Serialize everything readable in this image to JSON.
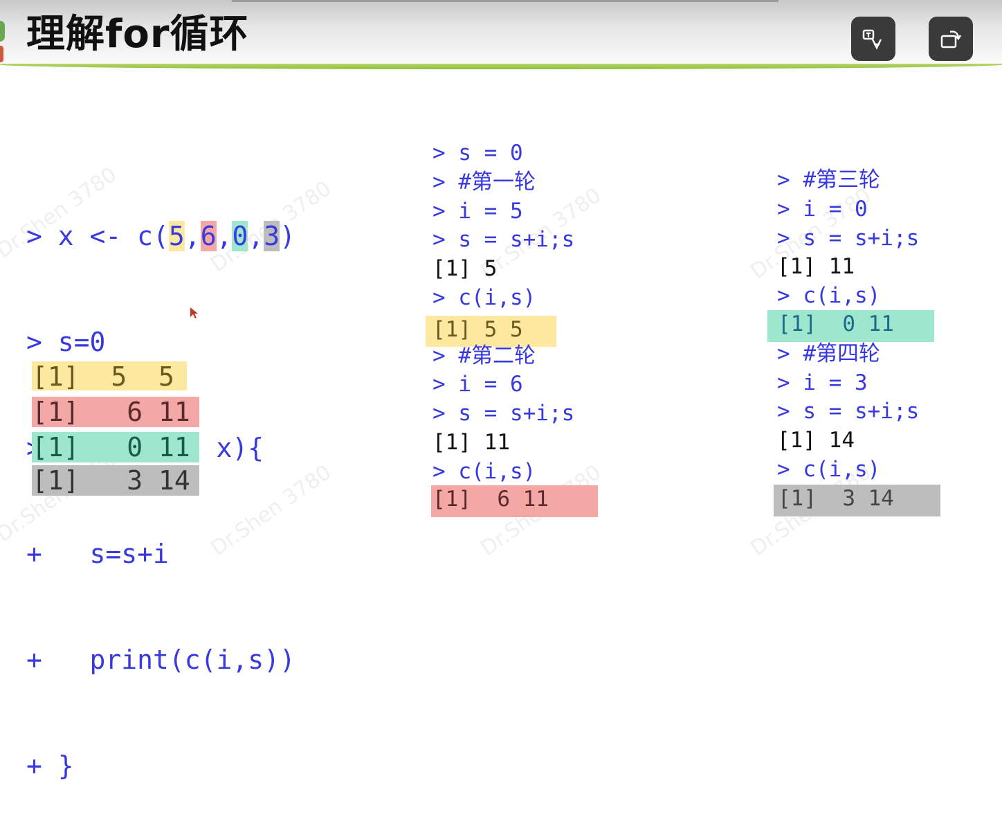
{
  "header": {
    "title": "理解for循环",
    "buttons": [
      {
        "name": "translate",
        "icon": "translate-icon"
      },
      {
        "name": "rotate",
        "icon": "rotate-screen-icon"
      }
    ]
  },
  "colors": {
    "code_blue": "#3939e0",
    "yellow": "#fde8a0",
    "red": "#f4a8a6",
    "green": "#9fe6ce",
    "gray": "#bdbdbd",
    "header_green": "#8cbf3b"
  },
  "left_code": {
    "line1_prefix": "> x <- c(",
    "v1": "5",
    "v2": "6",
    "v3": "0",
    "v4": "3",
    "comma": ",",
    "line1_suffix": ")",
    "line2": "> s=0",
    "line3": "> for (i in x){",
    "line4": "+   s=s+i",
    "line5": "+   print(c(i,s))",
    "line6": "+ }",
    "outputs": [
      "[1]  5  5",
      "[1]   6 11",
      "[1]   0 11",
      "[1]   3 14"
    ]
  },
  "middle": {
    "lines": [
      {
        "text": "> s = 0",
        "color": "blue"
      },
      {
        "text": "> #第一轮",
        "color": "blue"
      },
      {
        "text": "> i = 5",
        "color": "blue"
      },
      {
        "text": "> s = s+i;s",
        "color": "blue"
      },
      {
        "text": "[1] 5",
        "color": "black"
      },
      {
        "text": "> c(i,s)",
        "color": "blue"
      },
      {
        "text": "",
        "color": "blue"
      },
      {
        "text": "> #第二轮",
        "color": "blue"
      },
      {
        "text": "> i = 6",
        "color": "blue"
      },
      {
        "text": "> s = s+i;s",
        "color": "blue"
      },
      {
        "text": "[1] 11",
        "color": "black"
      },
      {
        "text": "> c(i,s)",
        "color": "blue"
      }
    ],
    "band1": "[1] 5 5",
    "band2": "[1]  6 11"
  },
  "right": {
    "lines": [
      {
        "text": "> #第三轮",
        "color": "blue"
      },
      {
        "text": "> i = 0",
        "color": "blue"
      },
      {
        "text": "> s = s+i;s",
        "color": "blue"
      },
      {
        "text": "[1] 11",
        "color": "black"
      },
      {
        "text": "> c(i,s)",
        "color": "blue"
      },
      {
        "text": "",
        "color": "blue"
      },
      {
        "text": "> #第四轮",
        "color": "blue"
      },
      {
        "text": "> i = 3",
        "color": "blue"
      },
      {
        "text": "> s = s+i;s",
        "color": "blue"
      },
      {
        "text": "[1] 14",
        "color": "black"
      },
      {
        "text": "> c(i,s)",
        "color": "blue"
      }
    ],
    "band1": "[1]  0 11",
    "band2": "[1]  3 14"
  },
  "watermark": "Dr.Shen 3780"
}
